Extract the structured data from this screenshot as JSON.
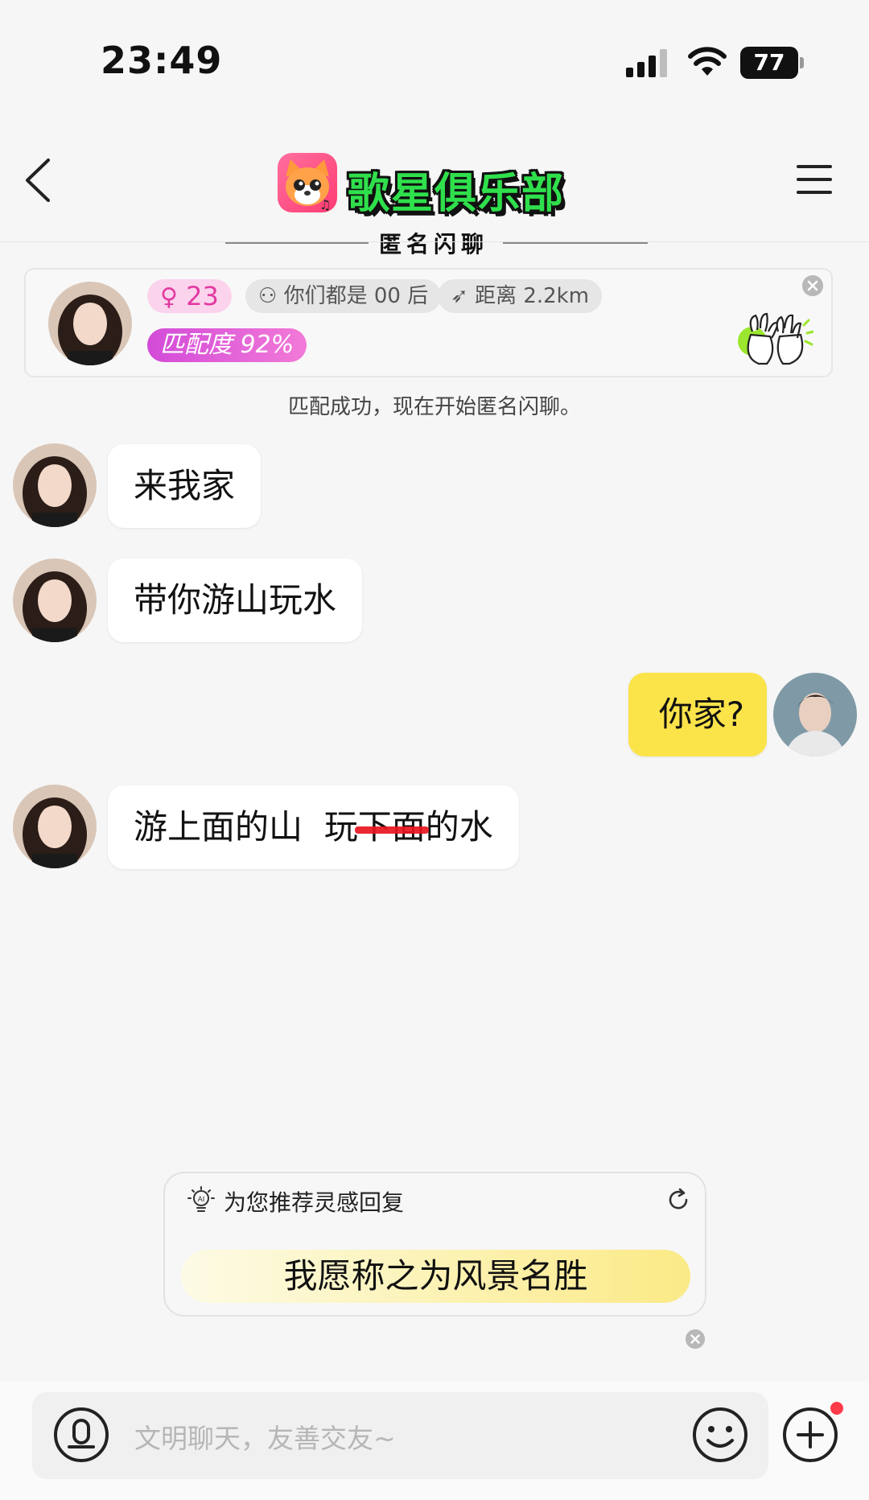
{
  "status_bar": {
    "time": "23:49",
    "battery": "77"
  },
  "header": {
    "title": "歌星俱乐部",
    "subtitle": "匿名闪聊",
    "back_icon": "chevron-left-icon",
    "menu_icon": "hamburger-menu-icon"
  },
  "match_card": {
    "age": "23",
    "gender_icon": "female-icon",
    "generation": "你们都是 00 后",
    "distance": "距离 2.2km",
    "match_rate": "匹配度 92%",
    "notice": "匹配成功，现在开始匿名闪聊。"
  },
  "messages": [
    {
      "sender": "other",
      "text": "来我家"
    },
    {
      "sender": "other",
      "text": "带你游山玩水"
    },
    {
      "sender": "me",
      "text": "你家?"
    },
    {
      "sender": "other",
      "text_before": "游上面的山  玩",
      "text_struck": "下面",
      "text_after": "的水"
    }
  ],
  "suggestion": {
    "title": "为您推荐灵感回复",
    "reply": "我愿称之为风景名胜"
  },
  "input": {
    "placeholder": "文明聊天，友善交友~"
  },
  "colors": {
    "accent_yellow": "#fbe34a",
    "brand_green": "#2fe04c",
    "match_pink": "#e23aa1",
    "badge_red": "#ff3b4a"
  }
}
